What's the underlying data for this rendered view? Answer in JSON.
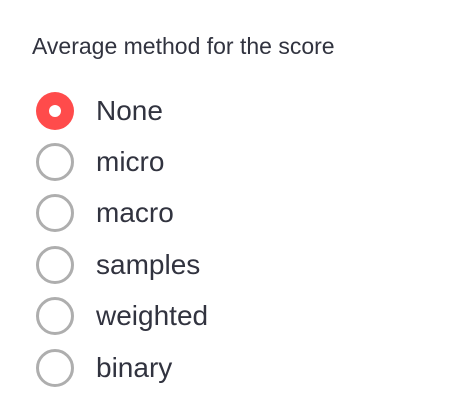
{
  "radio_group": {
    "label": "Average method for the score",
    "selected": "None",
    "accent_color": "#ff4b4b",
    "options": [
      {
        "label": "None",
        "checked": true
      },
      {
        "label": "micro",
        "checked": false
      },
      {
        "label": "macro",
        "checked": false
      },
      {
        "label": "samples",
        "checked": false
      },
      {
        "label": "weighted",
        "checked": false
      },
      {
        "label": "binary",
        "checked": false
      }
    ]
  }
}
